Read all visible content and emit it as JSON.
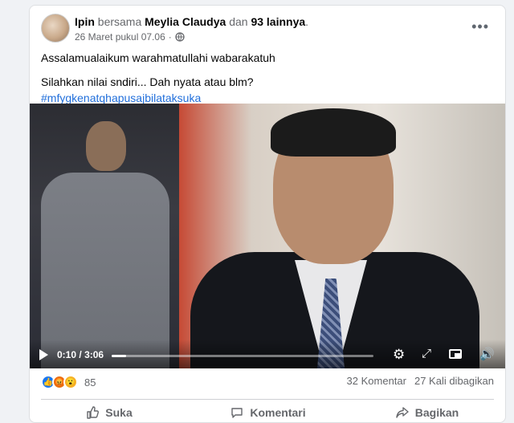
{
  "post": {
    "author": "Ipin",
    "with_word": "bersama",
    "tagged": "Meylia Claudya",
    "and_word": "dan",
    "others": "93 lainnya",
    "period": ".",
    "timestamp": "26 Maret pukul 07.06",
    "separator": "·",
    "audience_icon": "globe-icon",
    "more_icon": "•••",
    "line1": "Assalamualaikum warahmatullahi wabarakatuh",
    "line2": "Silahkan nilai sndiri... Dah nyata atau blm?",
    "hashtag": "#mfygkenatqhapusajbilataksuka"
  },
  "video": {
    "current_time": "0:10",
    "duration": "3:06",
    "time_separator": "/",
    "progress": 0.054,
    "gear": "⚙",
    "expand": "⤢",
    "volume": "🔊"
  },
  "stats": {
    "reaction_count": "85",
    "comments": "32 Komentar",
    "shares": "27 Kali dibagikan"
  },
  "actions": {
    "like": "Suka",
    "comment": "Komentari",
    "share": "Bagikan"
  },
  "colors": {
    "link": "#216fdb",
    "like": "#1877f2"
  }
}
